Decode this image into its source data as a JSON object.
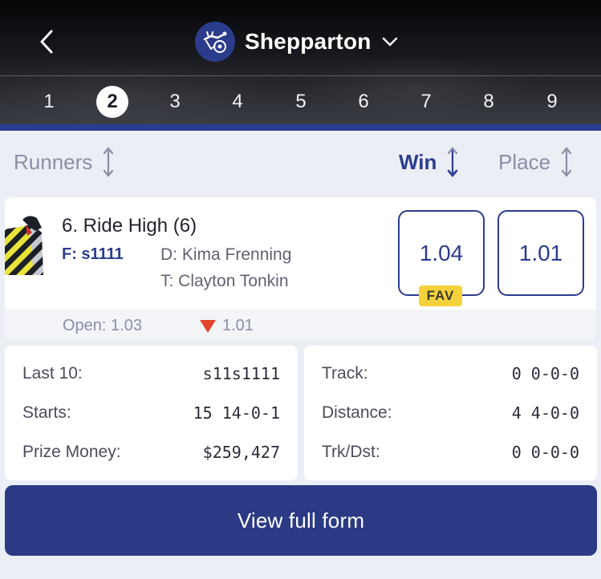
{
  "header": {
    "venue": "Shepparton",
    "venue_icon": "harness-racing-icon",
    "races": [
      "1",
      "2",
      "3",
      "4",
      "5",
      "6",
      "7",
      "8",
      "9"
    ],
    "active_race": "2"
  },
  "sort": {
    "runners": "Runners",
    "win": "Win",
    "place": "Place",
    "active": "Win"
  },
  "runner": {
    "name": "6. Ride High (6)",
    "form": "F: s1111",
    "driver": "D: Kima Frenning",
    "trainer": "T: Clayton Tonkin",
    "win_odds": "1.04",
    "place_odds": "1.01",
    "fav_label": "FAV",
    "open": "Open: 1.03",
    "current": "1.01",
    "trend": "down"
  },
  "stats_left": [
    {
      "label": "Last 10:",
      "value": "s11s1111"
    },
    {
      "label": "Starts:",
      "value": "15 14-0-1"
    },
    {
      "label": "Prize Money:",
      "value": "$259,427"
    }
  ],
  "stats_right": [
    {
      "label": "Track:",
      "value": "0 0-0-0"
    },
    {
      "label": "Distance:",
      "value": "4 4-0-0"
    },
    {
      "label": "Trk/Dst:",
      "value": "0 0-0-0"
    }
  ],
  "cta": "View full form",
  "colors": {
    "brand": "#2c3d8f",
    "fav": "#f5d23b",
    "down": "#e0452b",
    "background": "#eceef6"
  }
}
